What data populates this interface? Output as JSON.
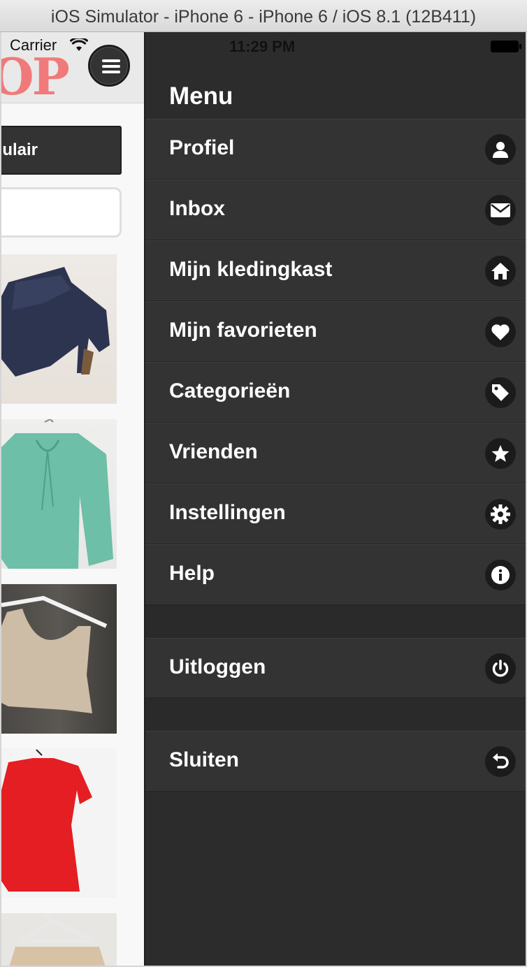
{
  "window": {
    "title": "iOS Simulator - iPhone 6 - iPhone 6 / iOS 8.1 (12B411)"
  },
  "status_bar": {
    "carrier": "Carrier",
    "time": "11:29 PM"
  },
  "app": {
    "logo_text": "OP",
    "popular_button_label": "ulair",
    "search_placeholder": ""
  },
  "drawer": {
    "title": "Menu",
    "items": [
      {
        "label": "Profiel",
        "icon": "user-icon"
      },
      {
        "label": "Inbox",
        "icon": "envelope-icon"
      },
      {
        "label": "Mijn kledingkast",
        "icon": "home-icon"
      },
      {
        "label": "Mijn favorieten",
        "icon": "heart-icon"
      },
      {
        "label": "Categorieën",
        "icon": "tag-icon"
      },
      {
        "label": "Vrienden",
        "icon": "star-icon"
      },
      {
        "label": "Instellingen",
        "icon": "gear-icon"
      },
      {
        "label": "Help",
        "icon": "info-icon"
      }
    ],
    "logout": {
      "label": "Uitloggen",
      "icon": "power-icon"
    },
    "close": {
      "label": "Sluiten",
      "icon": "undo-icon"
    }
  },
  "colors": {
    "drawer_bg": "#2c2c2c",
    "item_bg": "#333333",
    "icon_circle": "#1b1b1b",
    "logo": "#f07a7a"
  }
}
